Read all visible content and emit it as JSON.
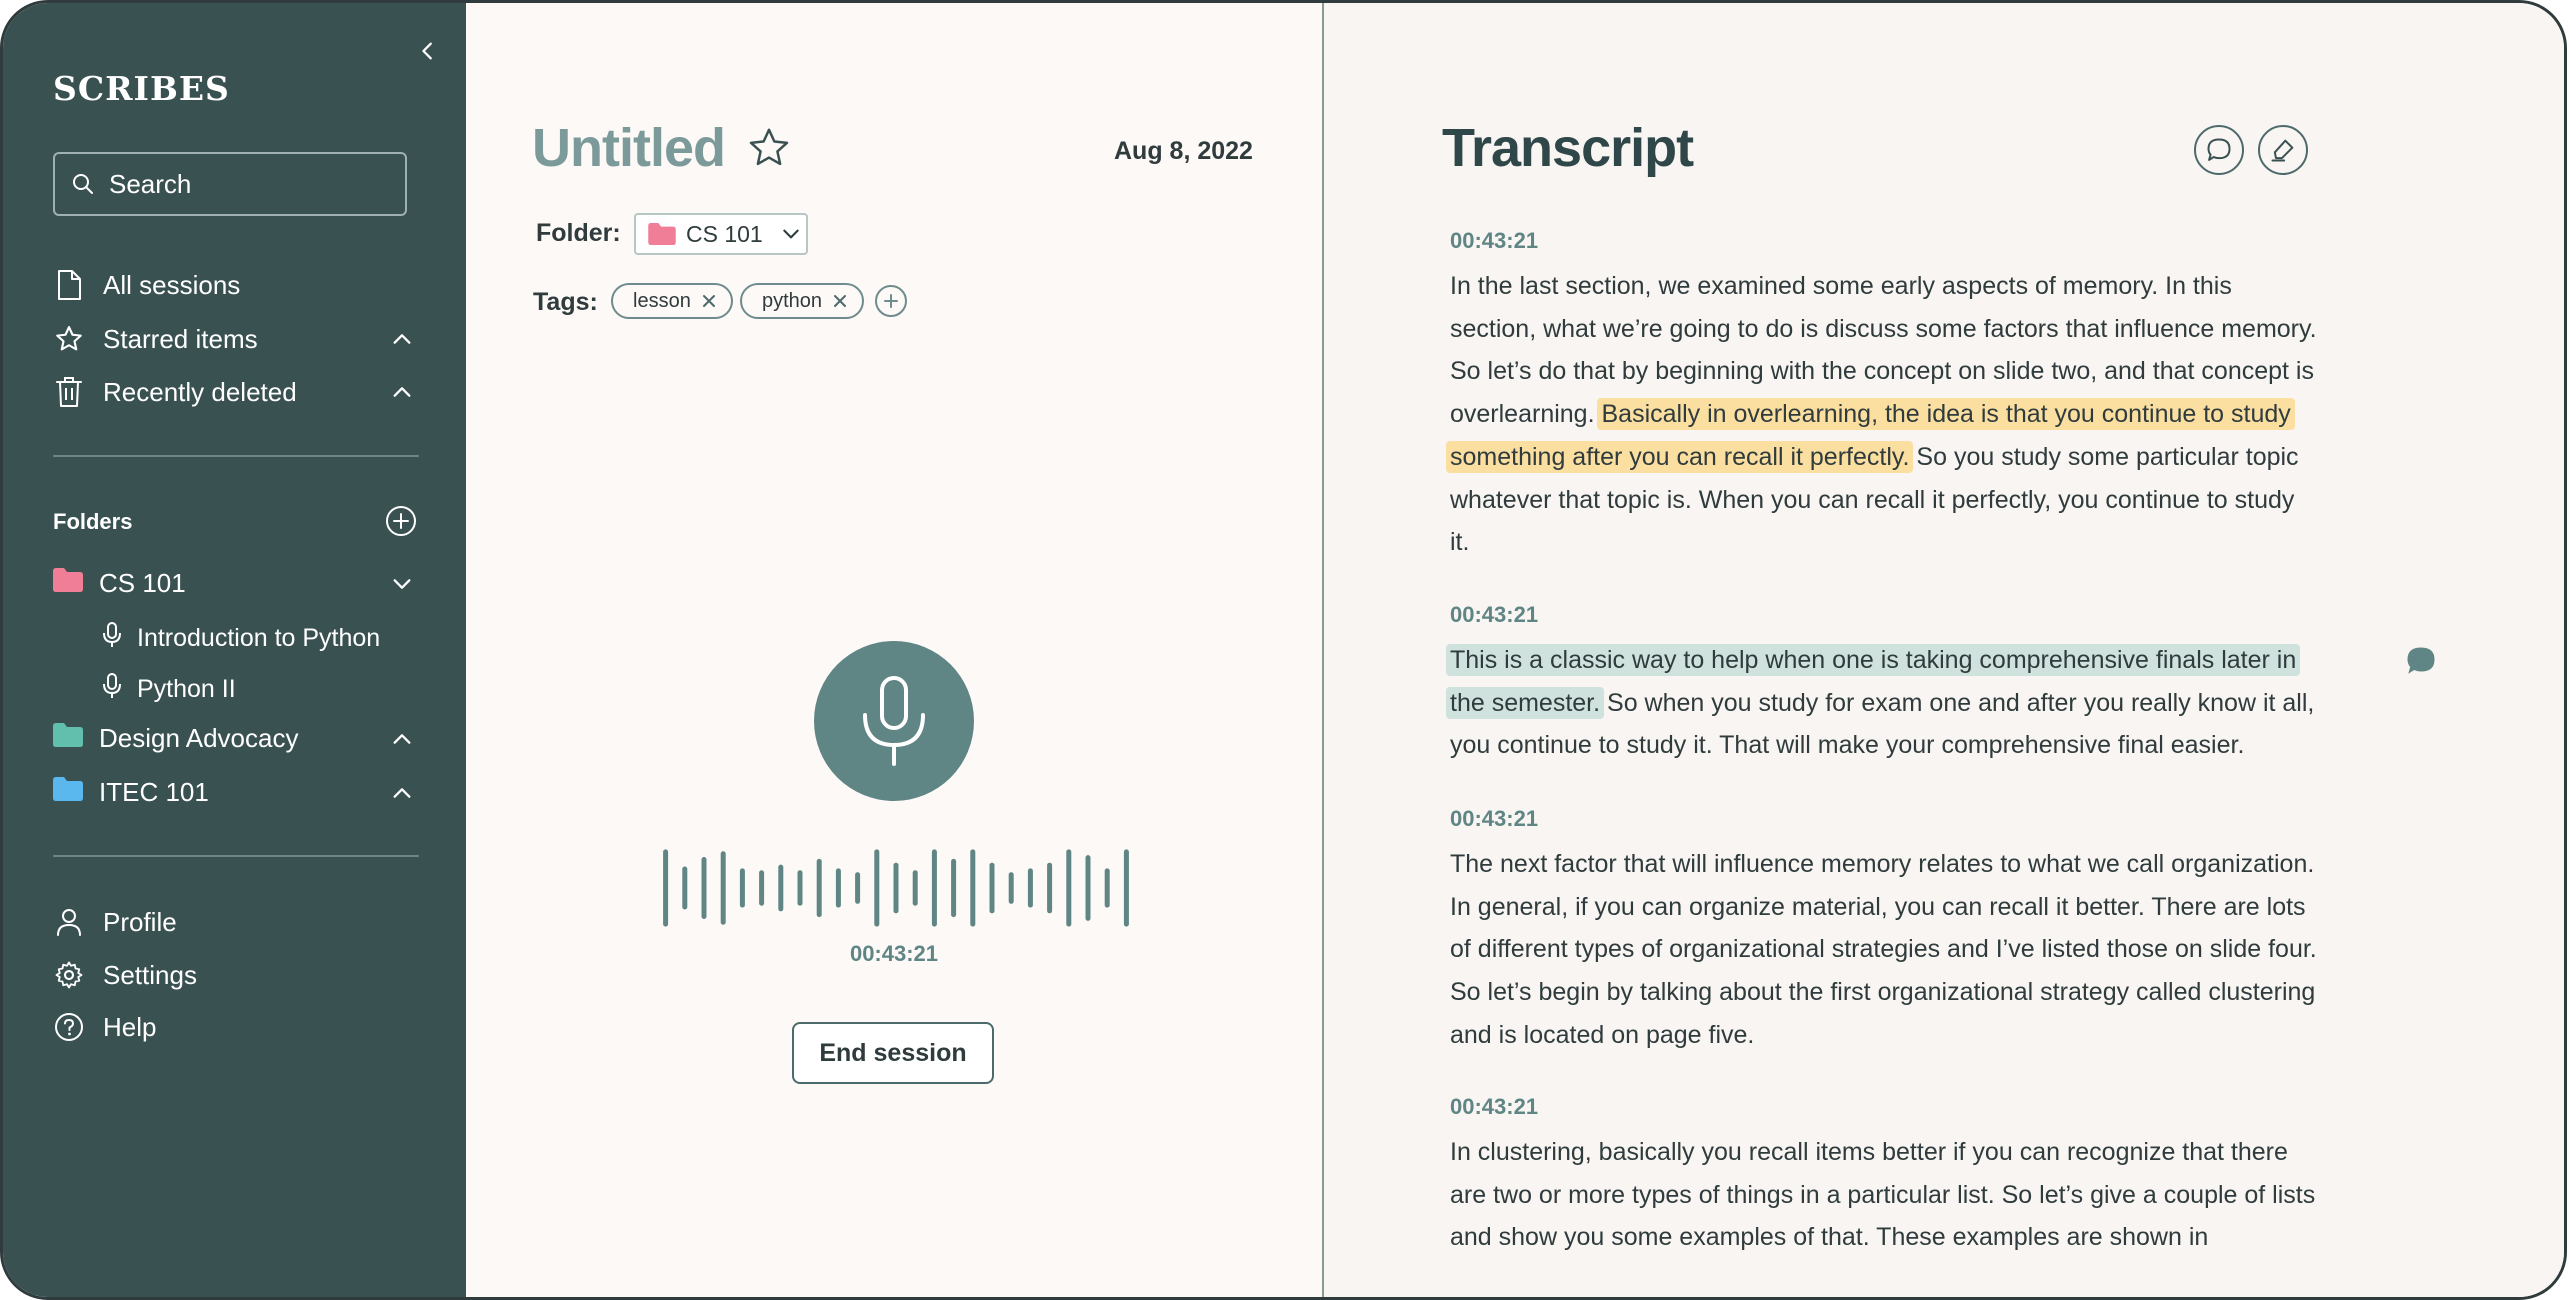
{
  "sidebar": {
    "logo": "SCRIBES",
    "search": {
      "placeholder": "Search"
    },
    "nav": [
      {
        "label": "All sessions",
        "icon": "document-icon"
      },
      {
        "label": "Starred items",
        "icon": "star-icon"
      },
      {
        "label": "Recently deleted",
        "icon": "trash-icon"
      }
    ],
    "folders_title": "Folders",
    "folders": [
      {
        "label": "CS 101",
        "color": "#f07e96",
        "expanded": true,
        "sessions": [
          {
            "label": "Introduction to Python"
          },
          {
            "label": "Python II"
          }
        ]
      },
      {
        "label": "Design Advocacy",
        "color": "#62bfae",
        "expanded": false
      },
      {
        "label": "ITEC 101",
        "color": "#5bb8ee",
        "expanded": false
      }
    ],
    "bottom": [
      {
        "label": "Profile",
        "icon": "user-icon"
      },
      {
        "label": "Settings",
        "icon": "gear-icon"
      },
      {
        "label": "Help",
        "icon": "help-icon"
      }
    ]
  },
  "session": {
    "title": "Untitled",
    "date": "Aug 8, 2022",
    "folder_label": "Folder:",
    "folder_value": "CS 101",
    "folder_color": "#f07e96",
    "tags_label": "Tags:",
    "tags": [
      "lesson",
      "python"
    ],
    "timer": "00:43:21",
    "end_button": "End session",
    "wave_levels": [
      0.95,
      0.5,
      0.75,
      0.9,
      0.45,
      0.4,
      0.55,
      0.4,
      0.7,
      0.45,
      0.35,
      0.95,
      0.6,
      0.4,
      0.95,
      0.7,
      0.95,
      0.6,
      0.35,
      0.45,
      0.6,
      0.95,
      0.8,
      0.45,
      0.95
    ]
  },
  "transcript": {
    "title": "Transcript",
    "blocks": [
      {
        "time": "00:43:21",
        "segments": [
          {
            "text": "In the last section, we examined some early aspects of memory. In this section, what we’re going to do is discuss some factors that influence memory. So let’s do that by beginning with the concept on slide two, and that concept is overlearning. ",
            "hl": ""
          },
          {
            "text": "Basically in overlearning, the idea is that you continue to study something after you can recall it perfectly.",
            "hl": "y"
          },
          {
            "text": " So you study some particular topic whatever that topic is. When you can recall it perfectly, you continue to study it.",
            "hl": ""
          }
        ]
      },
      {
        "time": "00:43:21",
        "segments": [
          {
            "text": "This is a classic way to help when one is taking comprehensive finals later in the semester.",
            "hl": "g"
          },
          {
            "text": " So when you study for exam one and after you really know it all, you continue to study it. That will make your comprehensive final easier.",
            "hl": ""
          }
        ]
      },
      {
        "time": "00:43:21",
        "segments": [
          {
            "text": "The next factor that will influence memory relates to what we call organization. In general, if you can organize material, you can recall it better. There are lots of different types of organizational strategies and I’ve listed those on slide four. So let’s begin by talking about the first organizational strategy called clustering and is located on page five.",
            "hl": ""
          }
        ]
      },
      {
        "time": "00:43:21",
        "segments": [
          {
            "text": "In clustering, basically you recall items better if you can recognize that there are two or more types of things in a particular list. So let’s give a couple of lists and show you some examples of that. These examples are shown in",
            "hl": ""
          }
        ]
      }
    ]
  }
}
